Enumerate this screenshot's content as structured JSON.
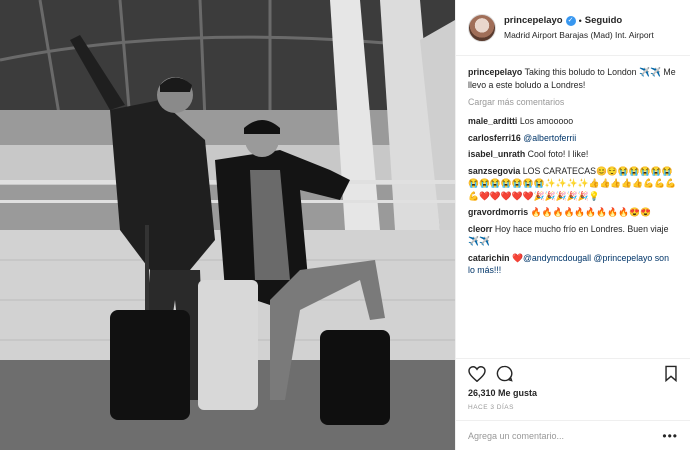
{
  "header": {
    "username": "princepelayo",
    "verified_icon": "verified-badge-icon",
    "separator": "•",
    "follow_status": "Seguido",
    "location": "Madrid Airport Barajas (Mad) Int. Airport"
  },
  "caption": {
    "username": "princepelayo",
    "text": "Taking this boludo to London ✈️✈️ Me llevo a este boludo a Londres!"
  },
  "load_more": "Cargar más comentarios",
  "comments": [
    {
      "user": "male_arditti",
      "text": "Los amooooo"
    },
    {
      "user": "carlosferri16",
      "text": "@albertoferrii"
    },
    {
      "user": "isabel_unrath",
      "text": "Cool foto! I like!"
    },
    {
      "user": "sanzsegovia",
      "text": "LOS CARATECAS😊😌😭😭😭😭😭😭😭😭😭😭😭😭✨✨✨✨👍👍👍👍👍💪💪💪💪❤️❤️❤️❤️❤️🎉🎉🎉🎉🎉💡"
    },
    {
      "user": "gravordmorris",
      "text": "🔥🔥🔥🔥🔥🔥🔥🔥🔥😍😍"
    },
    {
      "user": "cleorr",
      "text": "Hoy hace mucho frío en Londres. Buen viaje✈️✈️"
    },
    {
      "user": "catarichin",
      "text": "❤️@andymcdougall @princepelayo son lo más!!!"
    }
  ],
  "likes": "26,310 Me gusta",
  "timestamp": "HACE 3 DÍAS",
  "comment_input": {
    "placeholder": "Agrega un comentario..."
  },
  "icons": {
    "like": "heart-icon",
    "comment": "comment-bubble-icon",
    "save": "bookmark-icon",
    "more": "more-options-icon"
  }
}
